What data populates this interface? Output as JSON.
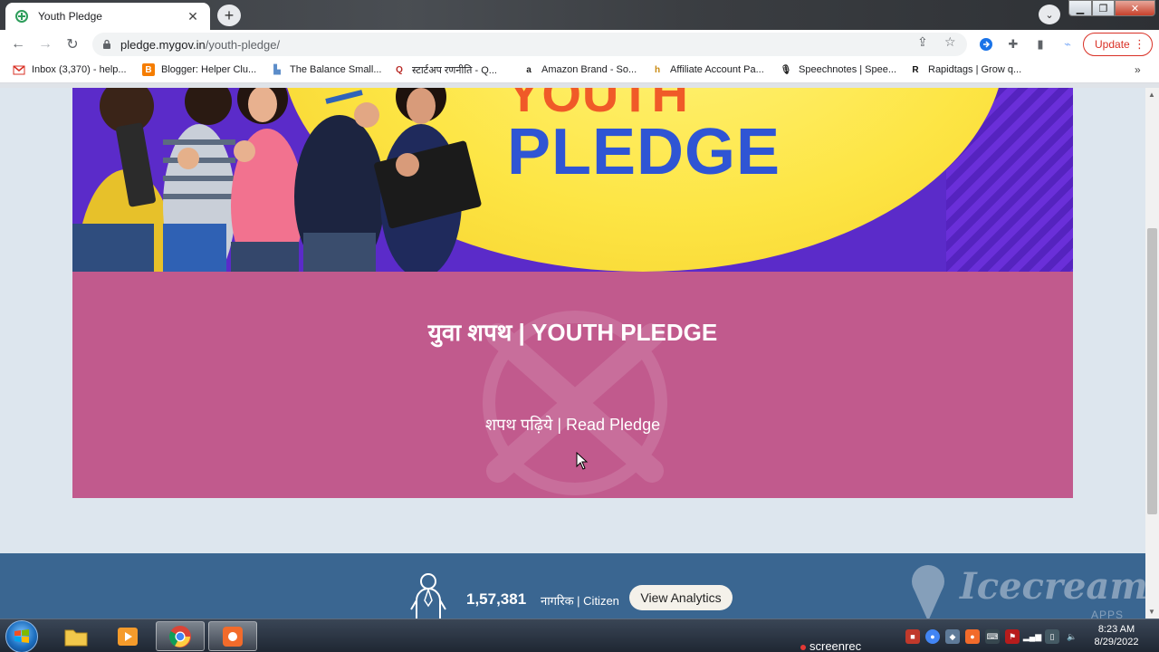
{
  "browser": {
    "tab_title": "Youth Pledge",
    "url_domain": "pledge.mygov.in",
    "url_path": "/youth-pledge/",
    "update_label": "Update"
  },
  "bookmarks": [
    {
      "label": "Inbox (3,370) - help...",
      "icon": "gmail-icon"
    },
    {
      "label": "Blogger: Helper Clu...",
      "icon": "blogger-icon"
    },
    {
      "label": "The Balance Small...",
      "icon": "balance-icon"
    },
    {
      "label": "स्टार्टअप रणनीति - Q...",
      "icon": "quora-icon"
    },
    {
      "label": "Amazon Brand - So...",
      "icon": "amazon-icon"
    },
    {
      "label": "Affiliate Account Pa...",
      "icon": "affiliate-icon"
    },
    {
      "label": "Speechnotes | Spee...",
      "icon": "microphone-icon"
    },
    {
      "label": "Rapidtags | Grow q...",
      "icon": "rapidtags-icon"
    }
  ],
  "banner": {
    "line1": "YOUTH",
    "line2": "PLEDGE"
  },
  "pledge_card": {
    "title": "युवा शपथ | YOUTH PLEDGE",
    "read_link": "शपथ पढ़िये | Read Pledge"
  },
  "stats": {
    "count": "1,57,381",
    "citizen_label": "नागरिक | Citizen",
    "analytics_button": "View Analytics"
  },
  "watermark": {
    "brand": "Icecream",
    "sub": "APPS"
  },
  "taskbar": {
    "screenrec_label": "screenrec",
    "time": "8:23 AM",
    "date": "8/29/2022"
  },
  "colors": {
    "pledge_card": "#c15a8d",
    "stats_bar": "#3a6691",
    "banner_orange": "#f05a28",
    "banner_blue": "#2f55d4",
    "update_red": "#d93025"
  }
}
